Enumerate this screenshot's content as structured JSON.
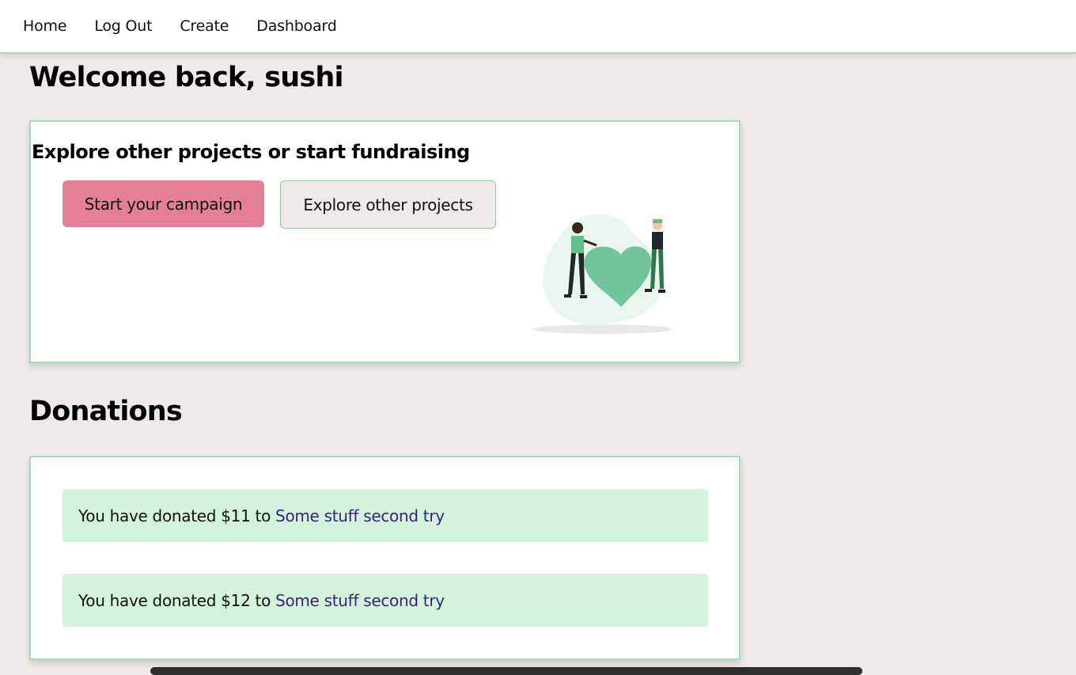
{
  "nav": {
    "items": [
      "Home",
      "Log Out",
      "Create",
      "Dashboard"
    ]
  },
  "welcome": {
    "text": "Welcome back, sushi"
  },
  "explore": {
    "title": "Explore other projects or start fundraising",
    "start_label": "Start your campaign",
    "explore_label": "Explore other projects"
  },
  "donations": {
    "title": "Donations",
    "items": [
      {
        "text": "You have donated $11 to",
        "link": "Some stuff second try"
      },
      {
        "text": "You have donated $12 to",
        "link": "Some stuff second try"
      }
    ]
  },
  "colors": {
    "background": "#efe9e9",
    "accent_green": "#a8dcb8",
    "start_button": "#e47f96",
    "donation_row": "#d4f3dc",
    "link": "#3b1f7a"
  }
}
